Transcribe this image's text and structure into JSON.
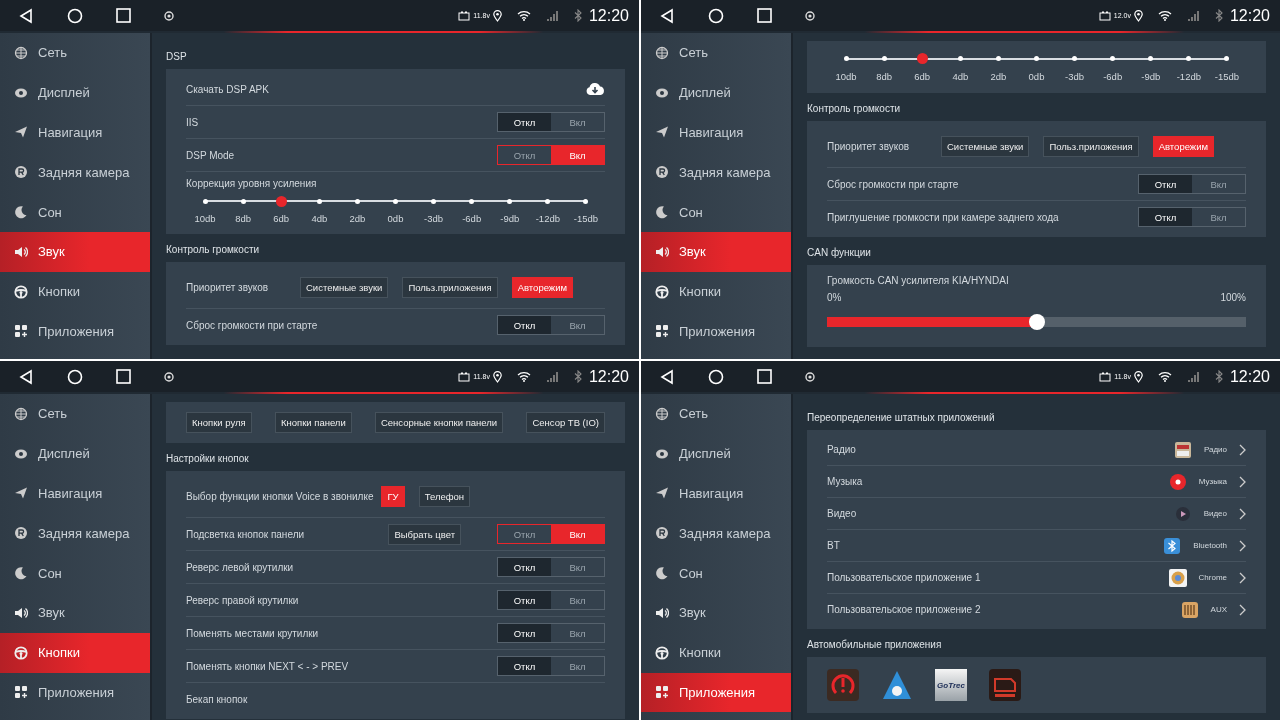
{
  "screens": [
    {
      "status": {
        "voltage": "11.8v",
        "time": "12:20"
      },
      "sidebar": [
        {
          "label": "Сеть",
          "selected": false
        },
        {
          "label": "Дисплей",
          "selected": false
        },
        {
          "label": "Навигация",
          "selected": false
        },
        {
          "label": "Задняя камера",
          "selected": false
        },
        {
          "label": "Сон",
          "selected": false
        },
        {
          "label": "Звук",
          "selected": true
        },
        {
          "label": "Кнопки",
          "selected": false
        },
        {
          "label": "Приложения",
          "selected": false
        }
      ],
      "content": [
        {
          "kind": "heading",
          "text": "DSP"
        },
        {
          "kind": "card",
          "rows": [
            {
              "kind": "text",
              "label": "Скачать DSP APK",
              "download": true
            },
            {
              "kind": "toggle",
              "label": "IIS",
              "off_label": "Откл",
              "on_label": "Вкл",
              "on": false
            },
            {
              "kind": "toggle",
              "label": "DSP Mode",
              "off_label": "Откл",
              "on_label": "Вкл",
              "on": true
            },
            {
              "kind": "steps",
              "label": "Коррекция уровня усиления",
              "steps": [
                {
                  "label": "10db",
                  "selected": false
                },
                {
                  "label": "8db",
                  "selected": false
                },
                {
                  "label": "6db",
                  "selected": true
                },
                {
                  "label": "4db",
                  "selected": false
                },
                {
                  "label": "2db",
                  "selected": false
                },
                {
                  "label": "0db",
                  "selected": false
                },
                {
                  "label": "-3db",
                  "selected": false
                },
                {
                  "label": "-6db",
                  "selected": false
                },
                {
                  "label": "-9db",
                  "selected": false
                },
                {
                  "label": "-12db",
                  "selected": false
                },
                {
                  "label": "-15db",
                  "selected": false
                }
              ]
            }
          ]
        },
        {
          "kind": "heading",
          "text": "Контроль громкости"
        },
        {
          "kind": "card",
          "rows": [
            {
              "kind": "choice",
              "label": "Приоритет звуков",
              "options": [
                {
                  "label": "Системные звуки",
                  "selected": false
                },
                {
                  "label": "Польз.приложения",
                  "selected": false
                },
                {
                  "label": "Авторежим",
                  "selected": true
                }
              ]
            },
            {
              "kind": "toggle",
              "label": "Сброс громкости при старте",
              "off_label": "Откл",
              "on_label": "Вкл",
              "on": false
            }
          ]
        }
      ]
    },
    {
      "status": {
        "voltage": "12.0v",
        "time": "12:20"
      },
      "sidebar": [
        {
          "label": "Сеть",
          "selected": false
        },
        {
          "label": "Дисплей",
          "selected": false
        },
        {
          "label": "Навигация",
          "selected": false
        },
        {
          "label": "Задняя камера",
          "selected": false
        },
        {
          "label": "Сон",
          "selected": false
        },
        {
          "label": "Звук",
          "selected": true
        },
        {
          "label": "Кнопки",
          "selected": false
        },
        {
          "label": "Приложения",
          "selected": false
        }
      ],
      "content": [
        {
          "kind": "card",
          "rows": [
            {
              "kind": "steps",
              "steps": [
                {
                  "label": "10db",
                  "selected": false
                },
                {
                  "label": "8db",
                  "selected": false
                },
                {
                  "label": "6db",
                  "selected": true
                },
                {
                  "label": "4db",
                  "selected": false
                },
                {
                  "label": "2db",
                  "selected": false
                },
                {
                  "label": "0db",
                  "selected": false
                },
                {
                  "label": "-3db",
                  "selected": false
                },
                {
                  "label": "-6db",
                  "selected": false
                },
                {
                  "label": "-9db",
                  "selected": false
                },
                {
                  "label": "-12db",
                  "selected": false
                },
                {
                  "label": "-15db",
                  "selected": false
                }
              ]
            }
          ]
        },
        {
          "kind": "heading",
          "text": "Контроль громкости"
        },
        {
          "kind": "card",
          "rows": [
            {
              "kind": "choice",
              "label": "Приоритет звуков",
              "options": [
                {
                  "label": "Системные звуки",
                  "selected": false
                },
                {
                  "label": "Польз.приложения",
                  "selected": false
                },
                {
                  "label": "Авторежим",
                  "selected": true
                }
              ]
            },
            {
              "kind": "toggle",
              "label": "Сброс громкости при старте",
              "off_label": "Откл",
              "on_label": "Вкл",
              "on": false
            },
            {
              "kind": "toggle",
              "label": "Приглушение громкости при камере заднего хода",
              "off_label": "Откл",
              "on_label": "Вкл",
              "on": false
            }
          ]
        },
        {
          "kind": "heading",
          "text": "CAN функции"
        },
        {
          "kind": "card",
          "rows": [
            {
              "kind": "level",
              "label": "Громкость CAN усилителя KIA/HYNDAI",
              "min_label": "0%",
              "max_label": "100%",
              "level": 0.5
            }
          ]
        }
      ]
    },
    {
      "status": {
        "voltage": "11.8v",
        "time": "12:20"
      },
      "sidebar": [
        {
          "label": "Сеть",
          "selected": false
        },
        {
          "label": "Дисплей",
          "selected": false
        },
        {
          "label": "Навигация",
          "selected": false
        },
        {
          "label": "Задняя камера",
          "selected": false
        },
        {
          "label": "Сон",
          "selected": false
        },
        {
          "label": "Звук",
          "selected": false
        },
        {
          "label": "Кнопки",
          "selected": true
        },
        {
          "label": "Приложения",
          "selected": false
        }
      ],
      "content": [
        {
          "kind": "card",
          "rows": [
            {
              "kind": "buttons",
              "buttons": [
                "Кнопки руля",
                "Кнопки панели",
                "Сенсорные кнопки панели",
                "Сенсор ТВ (IO)"
              ]
            }
          ]
        },
        {
          "kind": "heading",
          "text": "Настройки кнопок"
        },
        {
          "kind": "card",
          "rows": [
            {
              "kind": "choice",
              "label": "Выбор функции кнопки Voice в звонилке",
              "options": [
                {
                  "label": "ГУ",
                  "selected": true
                },
                {
                  "label": "Телефон",
                  "selected": false
                }
              ]
            },
            {
              "kind": "toggle",
              "label": "Подсветка кнопок панели",
              "button": "Выбрать цвет",
              "off_label": "Откл",
              "on_label": "Вкл",
              "on": true
            },
            {
              "kind": "toggle",
              "label": "Реверс левой крутилки",
              "off_label": "Откл",
              "on_label": "Вкл",
              "on": false
            },
            {
              "kind": "toggle",
              "label": "Реверс правой крутилки",
              "off_label": "Откл",
              "on_label": "Вкл",
              "on": false
            },
            {
              "kind": "toggle",
              "label": "Поменять местами крутилки",
              "off_label": "Откл",
              "on_label": "Вкл",
              "on": false
            },
            {
              "kind": "toggle",
              "label": "Поменять кнопки NEXT < - > PREV",
              "off_label": "Откл",
              "on_label": "Вкл",
              "on": false
            },
            {
              "kind": "text",
              "label": "Бекап кнопок"
            }
          ]
        }
      ]
    },
    {
      "status": {
        "voltage": "11.8v",
        "time": "12:20"
      },
      "sidebar": [
        {
          "label": "Сеть",
          "selected": false
        },
        {
          "label": "Дисплей",
          "selected": false
        },
        {
          "label": "Навигация",
          "selected": false
        },
        {
          "label": "Задняя камера",
          "selected": false
        },
        {
          "label": "Сон",
          "selected": false
        },
        {
          "label": "Звук",
          "selected": false
        },
        {
          "label": "Кнопки",
          "selected": false
        },
        {
          "label": "Приложения",
          "selected": true
        }
      ],
      "content": [
        {
          "kind": "heading",
          "text": "Переопределение штатных приложений"
        },
        {
          "kind": "card",
          "rows": [
            {
              "kind": "app",
              "label": "Радио",
              "app_name": "Радио"
            },
            {
              "kind": "app",
              "label": "Музыка",
              "app_name": "Музыка"
            },
            {
              "kind": "app",
              "label": "Видео",
              "app_name": "Видео"
            },
            {
              "kind": "app",
              "label": "BT",
              "app_name": "Bluetooth"
            },
            {
              "kind": "app",
              "label": "Пользовательское приложение 1",
              "app_name": "Chrome"
            },
            {
              "kind": "app",
              "label": "Пользовательское приложение 2",
              "app_name": "AUX"
            }
          ]
        },
        {
          "kind": "heading",
          "text": "Автомобильные приложения"
        },
        {
          "kind": "card",
          "rows": [
            {
              "kind": "apps",
              "apps": [
                {
                  "kind": "tpms"
                },
                {
                  "kind": "nav"
                },
                {
                  "kind": "logo",
                  "text": "GoTrec"
                },
                {
                  "kind": "obd"
                }
              ]
            }
          ]
        }
      ]
    }
  ]
}
